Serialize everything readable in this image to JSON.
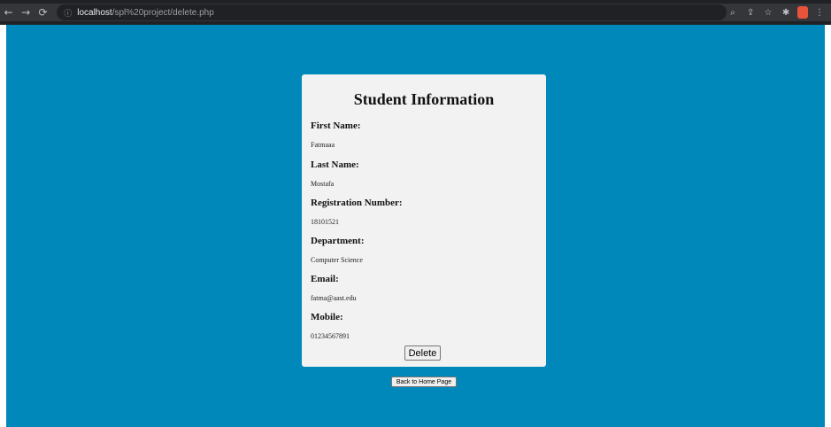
{
  "browser": {
    "url_host": "localhost",
    "url_path": "/spl%20project/delete.php"
  },
  "page": {
    "title": "Student Information",
    "fields": [
      {
        "label": "First Name:",
        "value": "Fatmaaa"
      },
      {
        "label": "Last Name:",
        "value": "Mostafa"
      },
      {
        "label": "Registration Number:",
        "value": "18101521"
      },
      {
        "label": "Department:",
        "value": "Computer Science"
      },
      {
        "label": "Email:",
        "value": "fatma@aast.edu"
      },
      {
        "label": "Mobile:",
        "value": "01234567891"
      }
    ],
    "delete_label": "Delete",
    "home_label": "Back to Home Page"
  },
  "colors": {
    "page_background": "#0088bb",
    "card_background": "#f2f2f2"
  }
}
